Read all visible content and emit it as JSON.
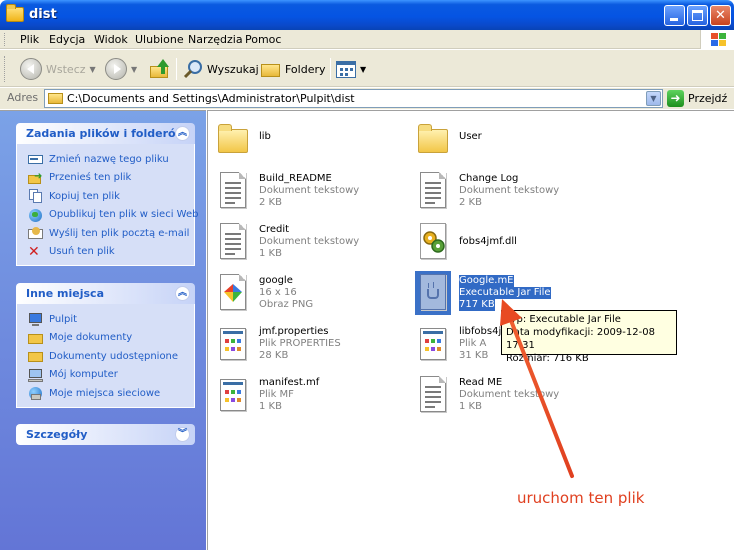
{
  "window": {
    "title": "dist"
  },
  "menu": [
    "Plik",
    "Edycja",
    "Widok",
    "Ulubione",
    "Narzędzia",
    "Pomoc"
  ],
  "toolbar": {
    "back": "Wstecz",
    "search": "Wyszukaj",
    "folders": "Foldery"
  },
  "address": {
    "label": "Adres",
    "path": "C:\\Documents and Settings\\Administrator\\Pulpit\\dist",
    "go": "Przejdź"
  },
  "tasks_panel": {
    "title": "Zadania plików i folderów",
    "items": [
      {
        "label": "Zmień nazwę tego pliku",
        "icon": "rename-icon"
      },
      {
        "label": "Przenieś ten plik",
        "icon": "move-icon"
      },
      {
        "label": "Kopiuj ten plik",
        "icon": "copy-icon"
      },
      {
        "label": "Opublikuj ten plik w sieci Web",
        "icon": "publish-web-icon"
      },
      {
        "label": "Wyślij ten plik pocztą e-mail",
        "icon": "email-icon"
      },
      {
        "label": "Usuń ten plik",
        "icon": "delete-icon"
      }
    ]
  },
  "places_panel": {
    "title": "Inne miejsca",
    "items": [
      {
        "label": "Pulpit",
        "icon": "desktop-icon"
      },
      {
        "label": "Moje dokumenty",
        "icon": "my-documents-icon"
      },
      {
        "label": "Dokumenty udostępnione",
        "icon": "shared-documents-icon"
      },
      {
        "label": "Mój komputer",
        "icon": "my-computer-icon"
      },
      {
        "label": "Moje miejsca sieciowe",
        "icon": "network-places-icon"
      }
    ]
  },
  "details_panel": {
    "title": "Szczegóły"
  },
  "files": [
    {
      "name": "lib",
      "type": "",
      "size": "",
      "icon": "folder-icon"
    },
    {
      "name": "User",
      "type": "",
      "size": "",
      "icon": "folder-icon"
    },
    {
      "name": "Build_README",
      "type": "Dokument tekstowy",
      "size": "2 KB",
      "icon": "text-document-icon"
    },
    {
      "name": "Change Log",
      "type": "Dokument tekstowy",
      "size": "2 KB",
      "icon": "text-document-icon"
    },
    {
      "name": "Credit",
      "type": "Dokument tekstowy",
      "size": "1 KB",
      "icon": "text-document-icon"
    },
    {
      "name": "fobs4jmf.dll",
      "type": "",
      "size": "",
      "icon": "dll-icon"
    },
    {
      "name": "google",
      "type": "16 x 16",
      "size": "Obraz PNG",
      "icon": "png-image-icon"
    },
    {
      "name": "Google.mE",
      "type": "Executable Jar File",
      "size": "717 KB",
      "icon": "jar-icon",
      "selected": true
    },
    {
      "name": "jmf.properties",
      "type": "Plik PROPERTIES",
      "size": "28 KB",
      "icon": "properties-file-icon"
    },
    {
      "name": "libfobs4jmf",
      "type": "Plik A",
      "size": "31 KB",
      "icon": "archive-file-icon"
    },
    {
      "name": "manifest.mf",
      "type": "Plik MF",
      "size": "1 KB",
      "icon": "mf-file-icon"
    },
    {
      "name": "Read ME",
      "type": "Dokument tekstowy",
      "size": "1 KB",
      "icon": "text-document-icon"
    }
  ],
  "tooltip": {
    "line1": "Typ: Executable Jar File",
    "line2": "Data modyfikacji: 2009-12-08 17:31",
    "line3": "Rozmiar: 716 KB"
  },
  "annotation": {
    "text": "uruchom ten plik",
    "color": "#e04020"
  },
  "colors": {
    "titlebar": "#0554e3",
    "panel_link": "#215dc6",
    "selection": "#316ac5"
  }
}
